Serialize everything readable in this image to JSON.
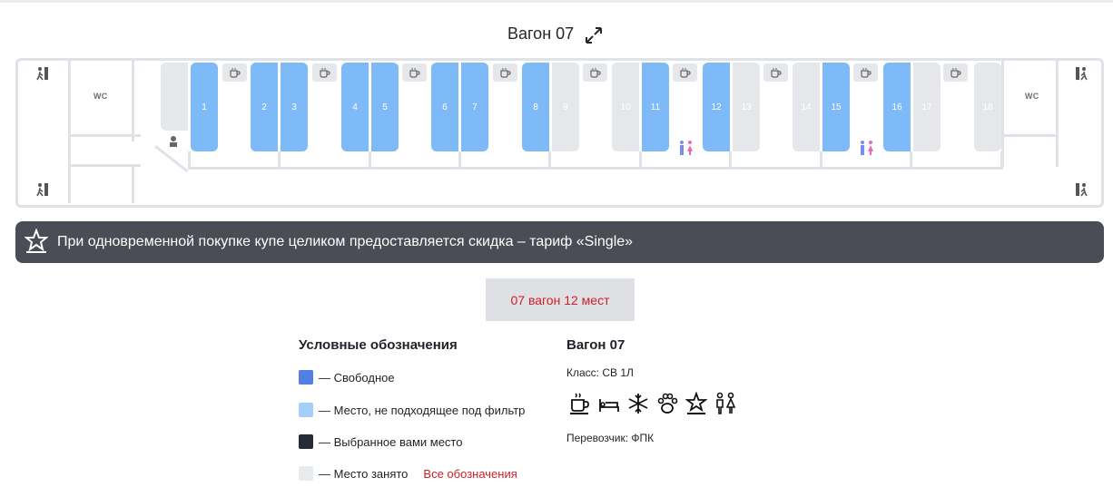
{
  "wagon": {
    "title": "Вагон 07"
  },
  "map": {
    "wc_label": "WC",
    "seats": [
      {
        "n": "1",
        "state": "free"
      },
      {
        "n": "2",
        "state": "free"
      },
      {
        "n": "3",
        "state": "free"
      },
      {
        "n": "4",
        "state": "free"
      },
      {
        "n": "5",
        "state": "free"
      },
      {
        "n": "6",
        "state": "free"
      },
      {
        "n": "7",
        "state": "free"
      },
      {
        "n": "8",
        "state": "free"
      },
      {
        "n": "9",
        "state": "busy"
      },
      {
        "n": "10",
        "state": "busy"
      },
      {
        "n": "11",
        "state": "free"
      },
      {
        "n": "12",
        "state": "free"
      },
      {
        "n": "13",
        "state": "busy"
      },
      {
        "n": "14",
        "state": "busy"
      },
      {
        "n": "15",
        "state": "free"
      },
      {
        "n": "16",
        "state": "free"
      },
      {
        "n": "17",
        "state": "busy"
      },
      {
        "n": "18",
        "state": "busy"
      }
    ],
    "icons": [
      "exit-icon",
      "cup-icon",
      "attendant-icon",
      "toilet-icon"
    ]
  },
  "banner": {
    "text": "При одновременной покупке купе целиком предоставляется скидка – тариф «Single»"
  },
  "coach_button": {
    "label": "07 вагон 12 мест"
  },
  "legend": {
    "title": "Условные обозначения",
    "items": [
      {
        "label": "— Свободное",
        "color": "#5080e0"
      },
      {
        "label": "— Место, не подходящее под фильтр",
        "color": "#a3cff8"
      },
      {
        "label": "— Выбранное вами место",
        "color": "#252a36"
      },
      {
        "label": "— Место занято",
        "color": "#e8ebee"
      }
    ],
    "all_link": "Все обозначения"
  },
  "info": {
    "title": "Вагон 07",
    "class": "Класс: СВ 1Л",
    "amenities": [
      "coffee-icon",
      "bed-icon",
      "snowflake-icon",
      "paw-icon",
      "star-icon",
      "people-icon"
    ],
    "carrier": "Перевозчик: ФПК"
  }
}
